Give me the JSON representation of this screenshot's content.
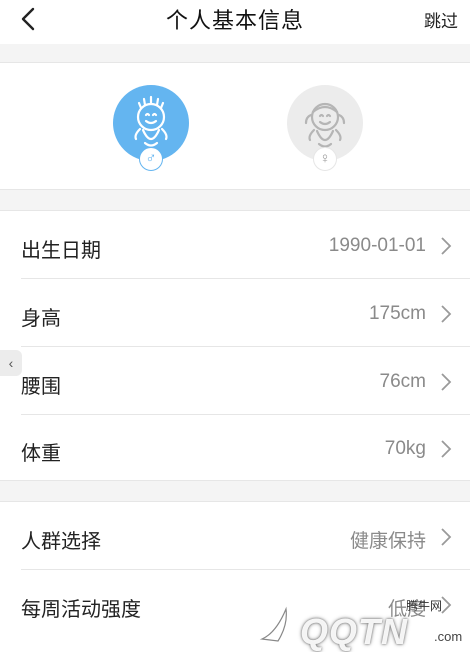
{
  "header": {
    "title": "个人基本信息",
    "skip_label": "跳过",
    "back_icon": "chevron-left-icon"
  },
  "gender": {
    "selected": "male",
    "male_symbol": "♂",
    "female_symbol": "♀",
    "male_color": "#64b5f0",
    "female_color": "#ececec"
  },
  "body_info": [
    {
      "label": "出生日期",
      "value": "1990-01-01"
    },
    {
      "label": "身高",
      "value": "175cm"
    },
    {
      "label": "腰围",
      "value": "76cm"
    },
    {
      "label": "体重",
      "value": "70kg"
    }
  ],
  "preferences": [
    {
      "label": "人群选择",
      "value": "健康保持"
    },
    {
      "label": "每周活动强度",
      "value": "低度"
    }
  ],
  "side_handle_glyph": "‹",
  "watermark": {
    "brand": "QQTN",
    "small": "腾牛网",
    "suffix": ".com"
  }
}
